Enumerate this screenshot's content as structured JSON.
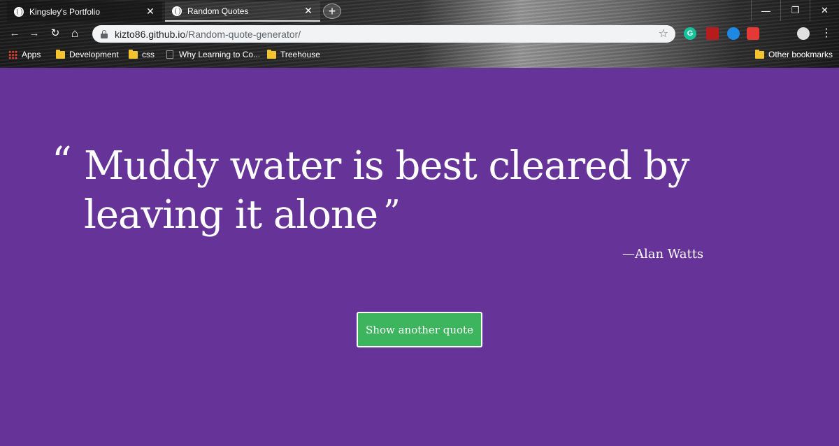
{
  "browser": {
    "tabs": [
      {
        "title": "Kingsley's Portfolio",
        "active": false
      },
      {
        "title": "Random Quotes",
        "active": true
      }
    ],
    "close_glyph": "✕",
    "new_tab_glyph": "+",
    "window_controls": {
      "minimize": "—",
      "restore": "❐",
      "close": "✕"
    },
    "nav": {
      "back": "←",
      "forward": "→",
      "reload": "↻",
      "home": "⌂"
    },
    "address": {
      "host": "kizto86.github.io",
      "path": "/Random-quote-generator/"
    },
    "star": "☆",
    "menu": "⋮",
    "extensions": [
      {
        "name": "grammarly-icon",
        "color": "#15c39a",
        "label": "G"
      },
      {
        "name": "pdf-icon",
        "color": "#b71c1c",
        "label": ""
      },
      {
        "name": "blue-extension-icon",
        "color": "#1e88e5",
        "label": ""
      },
      {
        "name": "printer-extension-icon",
        "color": "#e53935",
        "label": ""
      },
      {
        "name": "profile-avatar",
        "color": "#e0e0e0",
        "label": ""
      }
    ],
    "bookmarks": [
      {
        "label": "Apps",
        "icon": "apps-icon"
      },
      {
        "label": "Development",
        "icon": "folder-icon"
      },
      {
        "label": "css",
        "icon": "folder-icon"
      },
      {
        "label": "Why Learning to Co...",
        "icon": "page-icon"
      },
      {
        "label": "Treehouse",
        "icon": "folder-icon"
      },
      {
        "label": "Other bookmarks",
        "icon": "folder-icon"
      }
    ]
  },
  "page": {
    "background_color": "#663399",
    "quote": {
      "open_mark": "“",
      "text": "Muddy water is best cleared by leaving it alone",
      "close_mark": "”",
      "author": "—Alan Watts"
    },
    "button": {
      "label": "Show another quote",
      "color": "#3cb55e"
    }
  }
}
